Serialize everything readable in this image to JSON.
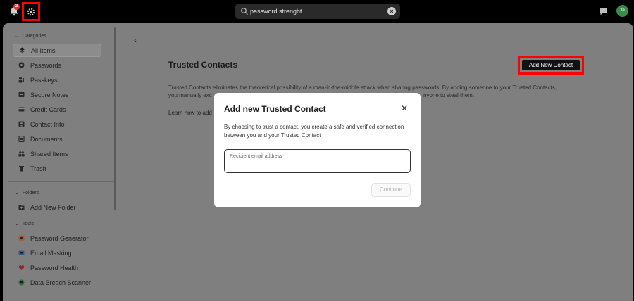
{
  "topbar": {
    "notification_count": "2",
    "search_value": "password strenght",
    "avatar_initials": "Te"
  },
  "sidebar": {
    "categories_label": "Categories",
    "items": [
      {
        "label": "All Items",
        "icon": "layers-icon",
        "active": true
      },
      {
        "label": "Passwords",
        "icon": "key-icon"
      },
      {
        "label": "Passkeys",
        "icon": "passkey-icon"
      },
      {
        "label": "Secure Notes",
        "icon": "note-icon"
      },
      {
        "label": "Credit Cards",
        "icon": "credit-card-icon"
      },
      {
        "label": "Contact Info",
        "icon": "contact-icon"
      },
      {
        "label": "Documents",
        "icon": "document-icon"
      },
      {
        "label": "Shared Items",
        "icon": "users-icon"
      },
      {
        "label": "Trash",
        "icon": "trash-icon"
      }
    ],
    "folders_label": "Folders",
    "add_folder_label": "Add New Folder",
    "tools_label": "Tools",
    "tools": [
      {
        "label": "Password Generator",
        "icon": "generator-icon"
      },
      {
        "label": "Email Masking",
        "icon": "mask-icon"
      },
      {
        "label": "Password Health",
        "icon": "health-icon"
      },
      {
        "label": "Data Breach Scanner",
        "icon": "scanner-icon"
      }
    ]
  },
  "content": {
    "title": "Trusted Contacts",
    "add_button_label": "Add New Contact",
    "desc_line1": "Trusted Contacts eliminates the theoretical possibility of a man-in-the-middle attack when sharing passwords. By adding someone to your Trusted Contacts,",
    "desc_line2_start": "you manually exc",
    "desc_line2_end": "nyone to steal them.",
    "learn_text": "Learn how to add"
  },
  "modal": {
    "title": "Add new Trusted Contact",
    "description": "By choosing to trust a contact, you create a safe and verified connection between you and your Trusted Contact",
    "field_placeholder": "Recipient email address",
    "field_value": "",
    "continue_label": "Continue"
  },
  "colors": {
    "highlight": "#ff0000",
    "overlay": "#7f7f7f"
  }
}
